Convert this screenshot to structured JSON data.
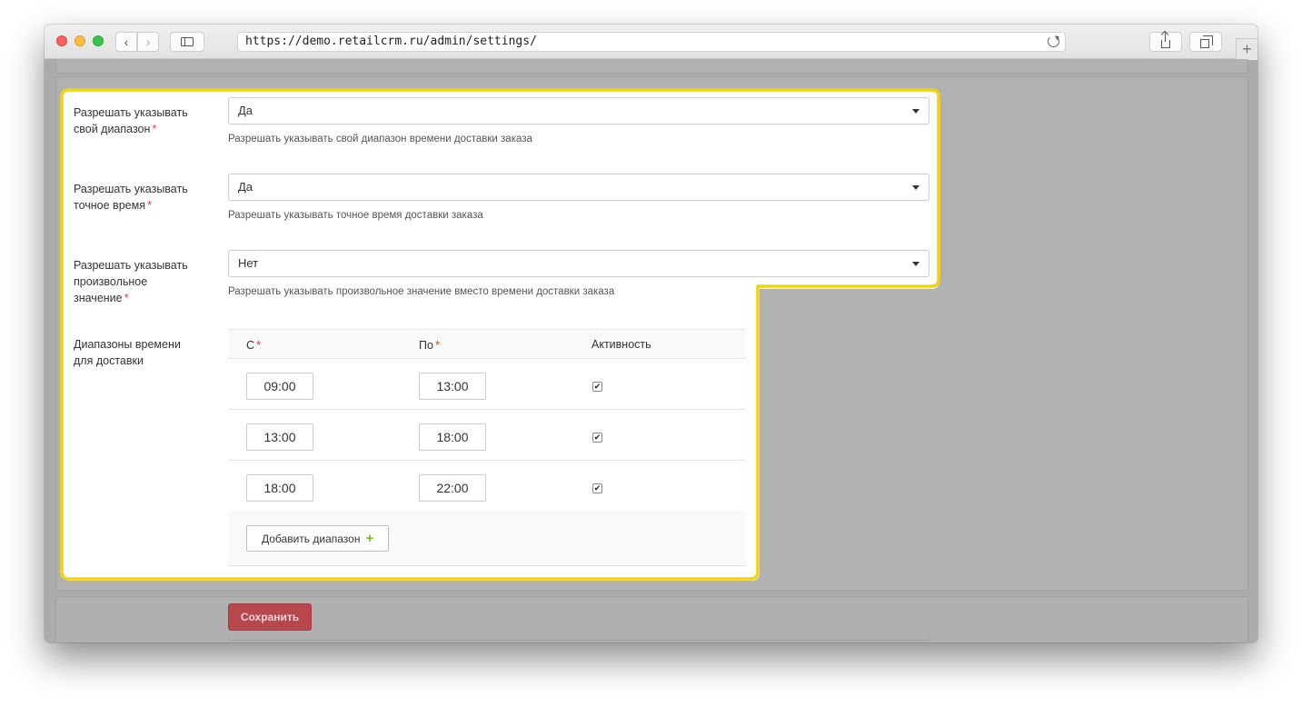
{
  "browser": {
    "url": "https://demo.retailcrm.ru/admin/settings/"
  },
  "settings": {
    "custom_range": {
      "label_line1": "Разрешать указывать",
      "label_line2": "свой диапазон",
      "value": "Да",
      "help": "Разрешать указывать свой диапазон времени доставки заказа"
    },
    "exact_time": {
      "label_line1": "Разрешать указывать",
      "label_line2": "точное время",
      "value": "Да",
      "help": "Разрешать указывать точное время доставки заказа"
    },
    "arbitrary_value": {
      "label_line1": "Разрешать указывать",
      "label_line2": "произвольное",
      "label_line3": "значение",
      "value": "Нет",
      "help": "Разрешать указывать произвольное значение вместо времени доставки заказа"
    },
    "required_mark": "*"
  },
  "ranges": {
    "label_line1": "Диапазоны времени",
    "label_line2": "для доставки",
    "columns": {
      "from": "С",
      "to": "По",
      "active": "Активность"
    },
    "rows": [
      {
        "from": "09:00",
        "to": "13:00",
        "active": true,
        "check": "✔"
      },
      {
        "from": "13:00",
        "to": "18:00",
        "active": true,
        "check": "✔"
      },
      {
        "from": "18:00",
        "to": "22:00",
        "active": true,
        "check": "✔"
      }
    ],
    "add_button": "Добавить диапазон",
    "add_icon": "+"
  },
  "footer": {
    "save_label": "Сохранить"
  },
  "colors": {
    "highlight": "#f5d20f",
    "save_button": "#b5474d",
    "plus_icon": "#7cbb2a",
    "required": "#e53935"
  }
}
